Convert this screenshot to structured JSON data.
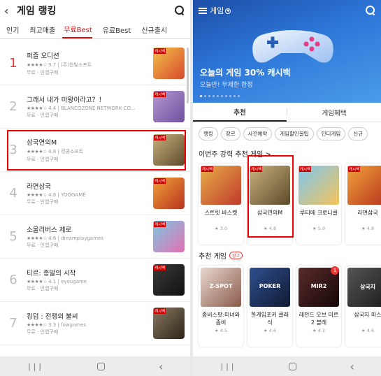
{
  "left": {
    "title": "게임 랭킹",
    "tabs": [
      "인기",
      "최고매출",
      "무료Best",
      "유료Best",
      "신규출시"
    ],
    "active_tab": "무료Best",
    "rows": [
      {
        "rank": "1",
        "name": "퍼즐 오디션",
        "rating": "3.7",
        "dev": "(주)한빛소프트",
        "price": "무료 · 인앱구매",
        "icon": "puzzle-audition-icon",
        "colors": [
          "#f2c24a",
          "#d9482b"
        ]
      },
      {
        "rank": "2",
        "name": "그래서 내가 마왕이라고？！",
        "rating": "4.4",
        "dev": "BLANCOZONE NETWORK CO...",
        "price": "무료 · 인앱구매",
        "icon": "demon-lord-icon",
        "colors": [
          "#b89ad4",
          "#6d4f9e"
        ]
      },
      {
        "rank": "3",
        "name": "삼국연의M",
        "rating": "4.8",
        "dev": "킹콩소프트",
        "price": "무료 · 인앱구매",
        "icon": "samguk-m-icon",
        "colors": [
          "#c9b27e",
          "#5c4a2a"
        ]
      },
      {
        "rank": "4",
        "name": "라면삼국",
        "rating": "4.8",
        "dev": "YOOGAME",
        "price": "무료 · 인앱구매",
        "icon": "ramen-samguk-icon",
        "colors": [
          "#f0a33a",
          "#b8321e"
        ]
      },
      {
        "rank": "5",
        "name": "소울리버스 제로",
        "rating": "4.6",
        "dev": "dreamplaygames",
        "price": "무료 · 인앱구매",
        "icon": "soul-reverse-icon",
        "colors": [
          "#7ec8e3",
          "#e26fb2"
        ]
      },
      {
        "rank": "6",
        "name": "티르: 종말의 시작",
        "rating": "4.1",
        "dev": "eyougame",
        "price": "무료 · 인앱구매",
        "icon": "tir-icon",
        "colors": [
          "#3a3a3a",
          "#111111"
        ]
      },
      {
        "rank": "7",
        "name": "킹덤 : 전쟁의 불씨",
        "rating": "3.3",
        "dev": "fowgames",
        "price": "무료 · 인앱구매",
        "icon": "kingdom-icon",
        "colors": [
          "#8a7a62",
          "#2c2418"
        ]
      }
    ],
    "stars": "★★★★☆"
  },
  "right": {
    "app_title": "게임",
    "banner_title": "오늘의 게임 30% 캐시백",
    "banner_sub": "오늘만! 무제한 한정",
    "tabs": [
      "추천",
      "게임혜택"
    ],
    "chips": [
      "랭킹",
      "장르",
      "사전예약",
      "게임할인꿀팁",
      "인디게임",
      "신규"
    ],
    "section1": "이번주 강력 추천 게임 >",
    "cards1": [
      {
        "name": "스트릿 바스켓",
        "rating": "★ 3.0",
        "colors": [
          "#e8b04a",
          "#c0392b"
        ]
      },
      {
        "name": "삼국연의M",
        "rating": "★ 4.8",
        "colors": [
          "#c9b27e",
          "#5c4a2a"
        ]
      },
      {
        "name": "루티에 크로니클",
        "rating": "★ 5.0",
        "colors": [
          "#7cc6ef",
          "#f4c45a"
        ]
      },
      {
        "name": "라면삼국",
        "rating": "★ 4.8",
        "colors": [
          "#f0a33a",
          "#b8321e"
        ]
      }
    ],
    "section2": "추천 게임",
    "ad_label": "광고",
    "cards2": [
      {
        "name": "좀비스팟:미녀와 좀비",
        "rating": "★ 4.5",
        "img_text": "Z-SPOT",
        "colors": [
          "#e9d7cf",
          "#8a5b4b"
        ]
      },
      {
        "name": "한게임포커 클래식",
        "rating": "★ 4.6",
        "img_text": "POKER",
        "colors": [
          "#2d4f8f",
          "#111a33"
        ]
      },
      {
        "name": "레전드 오브 미르2 블레",
        "rating": "★ 4.2",
        "img_text": "MIR2",
        "colors": [
          "#5a2a2a",
          "#150707"
        ]
      },
      {
        "name": "삼국지 마스",
        "rating": "★ 4.6",
        "img_text": "삼국지",
        "colors": [
          "#555555",
          "#1c1c1c"
        ]
      }
    ],
    "cashback_tag": "캐시백",
    "badge_count": "1"
  }
}
